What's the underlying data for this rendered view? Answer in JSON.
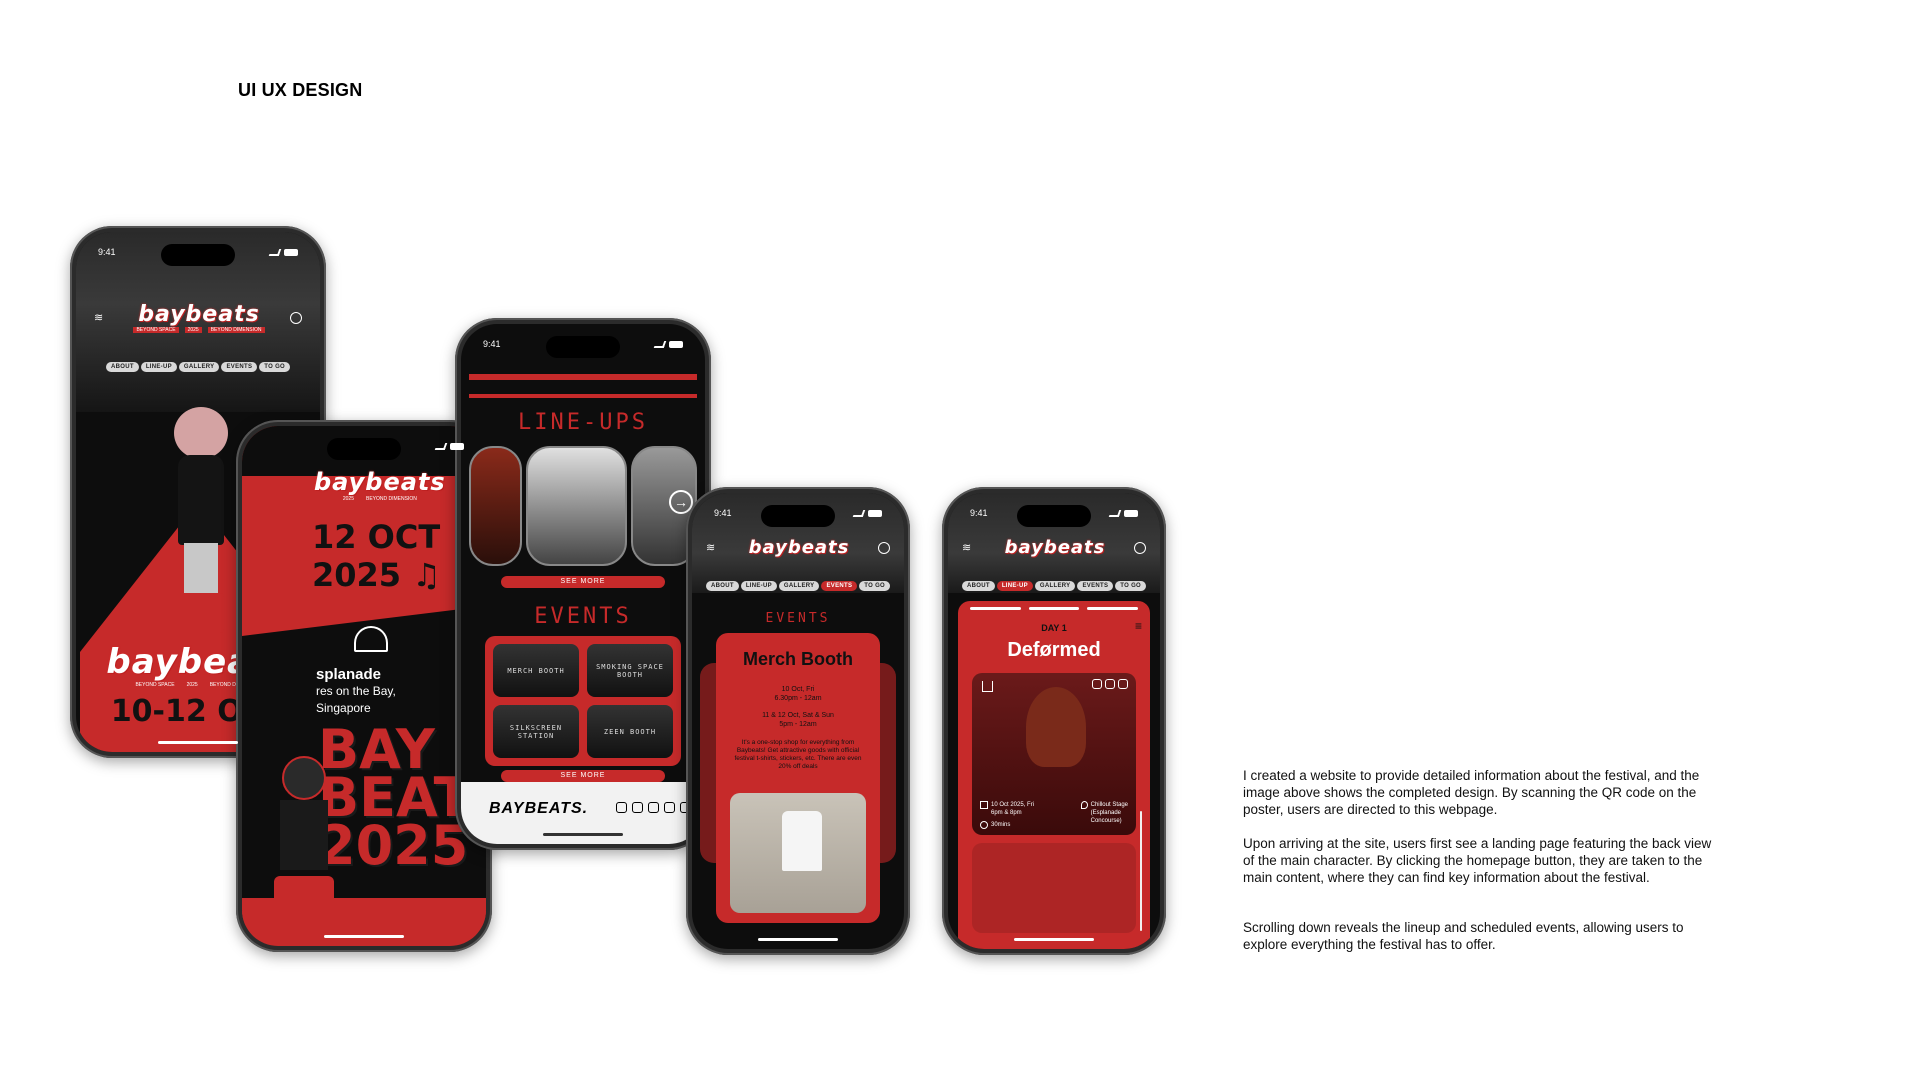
{
  "page": {
    "heading": "UI UX DESIGN"
  },
  "status": {
    "time": "9:41"
  },
  "brand": {
    "logo": "baybeats",
    "year": "2025",
    "tag_left": "BEYOND SPACE",
    "tag_right": "BEYOND DIMENSION",
    "footer_logo": "BAYBEATS."
  },
  "nav": [
    "ABOUT",
    "LINE-UP",
    "GALLERY",
    "EVENTS",
    "TO GO"
  ],
  "phone1": {
    "date": "10-12 OCT"
  },
  "phone2": {
    "date_line1": "12 OCT",
    "date_line2": "2025 ♫",
    "venue_name": "splanade",
    "venue_line2": "res on the Bay,",
    "venue_line3": "Singapore",
    "bay_line1": "BAY",
    "bay_line2": "BEATS",
    "bay_line3": "2025"
  },
  "phone3": {
    "lineups_title": "LINE-UPS",
    "events_title": "EVENTS",
    "see_more": "SEE MORE",
    "events": [
      "MERCH BOOTH",
      "SMOKING SPACE BOOTH",
      "SILKSCREEN STATION",
      "ZEEN BOOTH"
    ]
  },
  "phone4": {
    "events_title": "EVENTS",
    "card_title": "Merch Booth",
    "date1_line1": "10 Oct, Fri",
    "date1_line2": "6.30pm - 12am",
    "date2_line1": "11 & 12 Oct, Sat & Sun",
    "date2_line2": "5pm - 12am",
    "description": "It's a one-stop shop for everything from Baybeats! Get attractive goods with official festival t-shirts, stickers, etc. There are even 20% off deals"
  },
  "phone5": {
    "day": "DAY 1",
    "artist": "Deførmed",
    "date_line1": "10 Oct 2025, Fri",
    "date_line2": "6pm & 8pm",
    "duration": "30mins",
    "stage_line1": "Chillout Stage",
    "stage_line2": "(Esplanade",
    "stage_line3": "Concourse)"
  },
  "description": {
    "p1": "I created a website to provide detailed information about the festival, and the image above shows the completed design. By scanning the QR code on the poster, users are directed to this webpage.",
    "p2": "Upon arriving at the site, users first see a landing page featuring the back view of the main character. By clicking the homepage button, they are taken to the main content, where they can find key information about the festival.",
    "p3": "Scrolling down reveals the lineup and scheduled events, allowing users to explore everything the festival has to offer."
  },
  "colors": {
    "brand_red": "#c62a2a",
    "dark": "#0d0d0d"
  }
}
